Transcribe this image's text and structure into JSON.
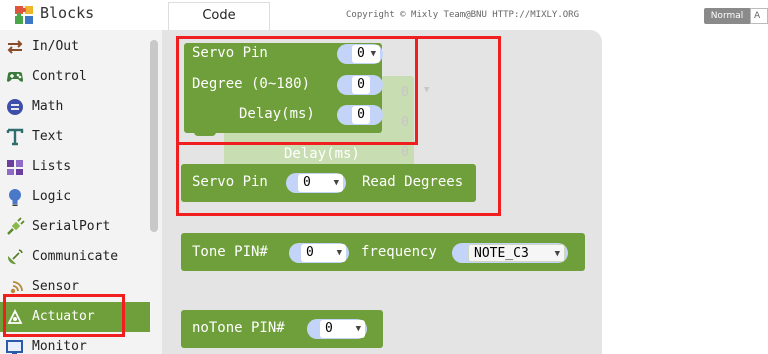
{
  "sidebar": {
    "header": {
      "title": "Blocks",
      "icon": "puzzle-icon"
    },
    "categories": [
      {
        "label": "In/Out",
        "icon": "swap-arrows-icon"
      },
      {
        "label": "Control",
        "icon": "gamepad-icon"
      },
      {
        "label": "Math",
        "icon": "math-icon"
      },
      {
        "label": "Text",
        "icon": "text-t-icon"
      },
      {
        "label": "Lists",
        "icon": "lists-icon"
      },
      {
        "label": "Logic",
        "icon": "bulb-icon"
      },
      {
        "label": "SerialPort",
        "icon": "plug-icon"
      },
      {
        "label": "Communicate",
        "icon": "satellite-icon"
      },
      {
        "label": "Sensor",
        "icon": "signal-icon"
      },
      {
        "label": "Actuator",
        "icon": "actuator-icon",
        "selected": true
      },
      {
        "label": "Monitor",
        "icon": "monitor-icon"
      }
    ]
  },
  "topbar": {
    "tab_code": "Code",
    "copyright": "Copyright © Mixly Team@BNU HTTP://MIXLY.ORG",
    "mode_normal": "Normal",
    "mode_advanced": "A"
  },
  "workspace": {
    "servo_write": {
      "pin_label": "Servo Pin",
      "pin_value": "0",
      "degree_label": "Degree (0~180)",
      "degree_value": "0",
      "delay_label": "Delay(ms)",
      "delay_value": "0"
    },
    "ghost_block": {
      "delay_label": "Delay(ms)",
      "values": [
        "0",
        "0",
        "0"
      ]
    },
    "servo_read": {
      "prefix": "Servo Pin",
      "pin_value": "0",
      "suffix": "Read Degrees"
    },
    "tone": {
      "prefix": "Tone PIN#",
      "pin_value": "0",
      "freq_label": "frequency",
      "freq_value": "NOTE_C3"
    },
    "notone": {
      "prefix": "noTone PIN#",
      "pin_value": "0"
    }
  },
  "colors": {
    "block_green": "#6f9f3a",
    "highlight_red": "#f01e1e",
    "slot_blue": "#c4d4f8"
  }
}
